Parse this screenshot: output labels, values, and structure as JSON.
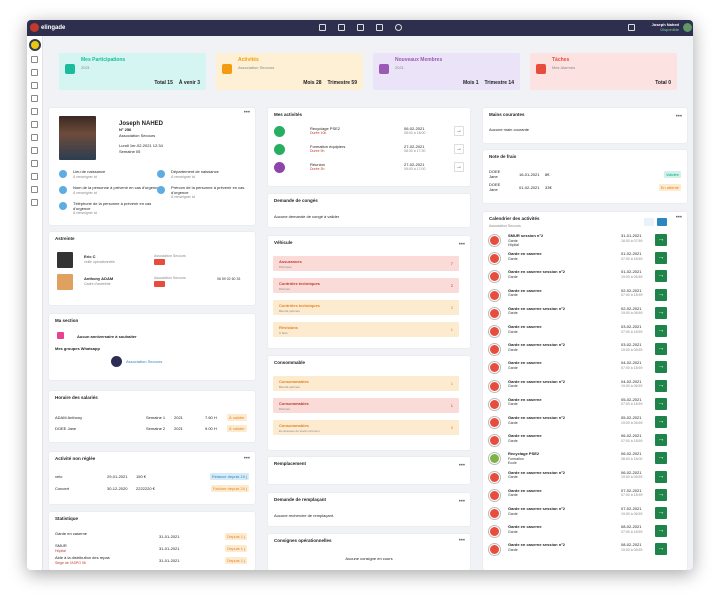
{
  "topbar": {
    "logo": "elingade",
    "user_name": "Joseph Nahed",
    "user_status": "Disponible"
  },
  "stats": [
    {
      "title": "Mes Participations",
      "subtitle": "2021",
      "v1": "Total 15",
      "v2": "À venir 3",
      "bg": "#d4f5f1",
      "icon_color": "#1abc9c"
    },
    {
      "title": "Activités",
      "subtitle": "Association Secours",
      "v1": "Mois 28",
      "v2": "Trimestre 59",
      "bg": "#fdf0d5",
      "icon_color": "#f39c12"
    },
    {
      "title": "Nouveaux Membres",
      "subtitle": "2021",
      "v1": "Mois 1",
      "v2": "Trimestre 14",
      "bg": "#ebe3f7",
      "icon_color": "#9b59b6"
    },
    {
      "title": "Tâches",
      "subtitle": "Mes Alarmes",
      "v1": "",
      "v2": "Total 0",
      "bg": "#fde2e2",
      "icon_color": "#e74c3c"
    }
  ],
  "profile": {
    "name": "Joseph NAHED",
    "number": "N° 256",
    "org": "Association Secours",
    "date": "Lundi 1er-02-2021 12:34",
    "week": "Semaine 05",
    "fields": [
      {
        "label": "Lieu de naissance",
        "sub": "À renseigner ici"
      },
      {
        "label": "Département de naissance",
        "sub": "À renseigner ici"
      },
      {
        "label": "Nom de la personne à prévenir en cas d'urgence",
        "sub": "À renseigner ici"
      },
      {
        "label": "Prénom de la personne à prévenir en cas d'urgence",
        "sub": "À renseigner ici"
      },
      {
        "label": "Téléphone de la personne à prévenir en cas d'urgence",
        "sub": "À renseigner ici"
      }
    ]
  },
  "astreinte": {
    "title": "Astreinte",
    "people": [
      {
        "name": "Eric C",
        "role": "veille opérationnelle",
        "org": "Association Secours",
        "phone": ""
      },
      {
        "name": "Anthony ADAM",
        "role": "Cadre d'astreinte",
        "org": "Association Secours",
        "phone": "06 59 02 60 33"
      }
    ]
  },
  "section": {
    "title": "Ma section",
    "empty": "Aucun anniversaire à souhaiter",
    "whatsapp_title": "Mes groupes Whatsapp",
    "whatsapp_link": "Association Secours"
  },
  "horaire": {
    "title": "Horaire des salariés",
    "rows": [
      {
        "name": "ADAM Anthony",
        "week": "Semaine 1",
        "year": "2021",
        "hours": "7.60 H",
        "status": "À valider"
      },
      {
        "name": "DOEE Jane",
        "week": "Semaine 2",
        "year": "2021",
        "hours": "9.00 H",
        "status": "À valider"
      }
    ]
  },
  "nonreglee": {
    "title": "Activité non réglée",
    "rows": [
      {
        "name": "velo",
        "date": "29-01-2021",
        "amount": "150 €",
        "status": "Relance depuis 10 j",
        "bg": "#d6eaf8",
        "fg": "#2e86c1"
      },
      {
        "name": "Concert",
        "date": "30-12-2020",
        "amount": "2222220 €",
        "status": "Facture depuis 24 j",
        "bg": "#fdebd0",
        "fg": "#e67e22"
      }
    ]
  },
  "statistique": {
    "title": "Statistique",
    "rows": [
      {
        "name": "Garde en caserne",
        "sub": "",
        "date": "31-01-2021",
        "status": "Depuis 1 j"
      },
      {
        "name": "SMUR",
        "sub": "Hôpital",
        "date": "31-01-2021",
        "status": "Depuis 1 j"
      },
      {
        "name": "Aide à la distribution des repas",
        "sub": "Siège de l'ASPO 96",
        "date": "31-01-2021",
        "status": "Depuis 1 j"
      }
    ]
  },
  "activites": {
    "title": "Mes activités",
    "items": [
      {
        "name": "Recyclage PSE2",
        "sub": "Durée 10h",
        "date": "06-02-2021",
        "time": "08:00 à 18:00",
        "color": "#27ae60"
      },
      {
        "name": "Formation équipiers",
        "sub": "Durée 9h",
        "date": "27-02-2021",
        "time": "08:30 à 17:30",
        "color": "#27ae60"
      },
      {
        "name": "Réunion",
        "sub": "Durée 3h",
        "date": "27-02-2021",
        "time": "09:00 à 17:00",
        "color": "#8e44ad"
      }
    ]
  },
  "conges": {
    "title": "Demande de congés",
    "empty": "Aucune demande de congé à valider"
  },
  "vehicule": {
    "title": "Véhicule",
    "items": [
      {
        "label": "Assurances",
        "sub": "Périmées",
        "count": "7",
        "bg": "#fadbd8",
        "fg": "#c0392b"
      },
      {
        "label": "Contrôles techniques",
        "sub": "Périmés",
        "count": "2",
        "bg": "#fadbd8",
        "fg": "#c0392b"
      },
      {
        "label": "Contrôles techniques",
        "sub": "Bientôt périmés",
        "count": "2",
        "bg": "#fdebd0",
        "fg": "#e67e22"
      },
      {
        "label": "Révisions",
        "sub": "À faire",
        "count": "1",
        "bg": "#fdebd0",
        "fg": "#e67e22"
      }
    ]
  },
  "consommable": {
    "title": "Consommable",
    "items": [
      {
        "label": "Consommables",
        "sub": "Bientôt périmés",
        "count": "1",
        "bg": "#fdebd0",
        "fg": "#e67e22"
      },
      {
        "label": "Consommables",
        "sub": "Périmés",
        "count": "1",
        "bg": "#fadbd8",
        "fg": "#c0392b"
      },
      {
        "label": "Consommables",
        "sub": "En dessous du stock minimum",
        "count": "3",
        "bg": "#fdebd0",
        "fg": "#e67e22"
      }
    ]
  },
  "remplacement": {
    "title": "Remplacement"
  },
  "demande_rempl": {
    "title": "Demande de remplaçant",
    "empty": "Aucune recherche de remplaçant."
  },
  "consignes": {
    "title": "Consignes opérationnelles",
    "empty": "Aucune consigne en cours"
  },
  "mains": {
    "title": "Mains courantes",
    "empty": "Aucune main courante"
  },
  "frais": {
    "title": "Note de frais",
    "rows": [
      {
        "name": "DOEE Jane",
        "date": "16-01-2021",
        "amount": "8€",
        "status": "Validée",
        "bg": "#d1f2eb",
        "fg": "#17a589"
      },
      {
        "name": "DOEE Jane",
        "date": "01-02-2021",
        "amount": "33€",
        "status": "En attente",
        "bg": "#fdebd0",
        "fg": "#e67e22"
      }
    ]
  },
  "calendrier": {
    "title": "Calendrier des activités",
    "org": "Association Secours",
    "items": [
      {
        "name": "SMUR session n°2",
        "sub": "Garde",
        "sub2": "Hôpital",
        "date": "31-01-2021",
        "time": "16:00 à 07:59",
        "green": false
      },
      {
        "name": "Garde en caserne",
        "sub": "Garde",
        "sub2": "",
        "date": "01-02-2021",
        "time": "07:00 à 18:59",
        "green": false
      },
      {
        "name": "Garde en caserne session n°2",
        "sub": "Garde",
        "sub2": "",
        "date": "01-02-2021",
        "time": "19:00 à 06:59",
        "green": false
      },
      {
        "name": "Garde en caserne",
        "sub": "Garde",
        "sub2": "",
        "date": "02-02-2021",
        "time": "07:00 à 18:59",
        "green": false
      },
      {
        "name": "Garde en caserne session n°2",
        "sub": "Garde",
        "sub2": "",
        "date": "02-02-2021",
        "time": "19:00 à 06:59",
        "green": false
      },
      {
        "name": "Garde en caserne",
        "sub": "Garde",
        "sub2": "",
        "date": "03-02-2021",
        "time": "07:00 à 18:59",
        "green": false
      },
      {
        "name": "Garde en caserne session n°2",
        "sub": "Garde",
        "sub2": "",
        "date": "03-02-2021",
        "time": "19:00 à 06:59",
        "green": false
      },
      {
        "name": "Garde en caserne",
        "sub": "Garde",
        "sub2": "",
        "date": "04-02-2021",
        "time": "07:00 à 18:59",
        "green": false
      },
      {
        "name": "Garde en caserne session n°2",
        "sub": "Garde",
        "sub2": "",
        "date": "04-02-2021",
        "time": "19:00 à 06:59",
        "green": false
      },
      {
        "name": "Garde en caserne",
        "sub": "Garde",
        "sub2": "",
        "date": "05-02-2021",
        "time": "07:00 à 18:59",
        "green": false
      },
      {
        "name": "Garde en caserne session n°2",
        "sub": "Garde",
        "sub2": "",
        "date": "05-02-2021",
        "time": "19:00 à 06:59",
        "green": false
      },
      {
        "name": "Garde en caserne",
        "sub": "Garde",
        "sub2": "",
        "date": "06-02-2021",
        "time": "07:00 à 18:59",
        "green": false
      },
      {
        "name": "Recyclage PSE2",
        "sub": "Formation",
        "sub2": "Ecole",
        "date": "06-02-2021",
        "time": "08:00 à 18:00",
        "green": true
      },
      {
        "name": "Garde en caserne session n°2",
        "sub": "Garde",
        "sub2": "",
        "date": "06-02-2021",
        "time": "19:00 à 06:59",
        "green": false
      },
      {
        "name": "Garde en caserne",
        "sub": "Garde",
        "sub2": "",
        "date": "07-02-2021",
        "time": "07:00 à 18:59",
        "green": false
      },
      {
        "name": "Garde en caserne session n°2",
        "sub": "Garde",
        "sub2": "",
        "date": "07-02-2021",
        "time": "19:00 à 06:59",
        "green": false
      },
      {
        "name": "Garde en caserne",
        "sub": "Garde",
        "sub2": "",
        "date": "08-02-2021",
        "time": "07:00 à 18:59",
        "green": false
      },
      {
        "name": "Garde en caserne session n°2",
        "sub": "Garde",
        "sub2": "",
        "date": "08-02-2021",
        "time": "19:00 à 06:59",
        "green": false
      }
    ]
  }
}
